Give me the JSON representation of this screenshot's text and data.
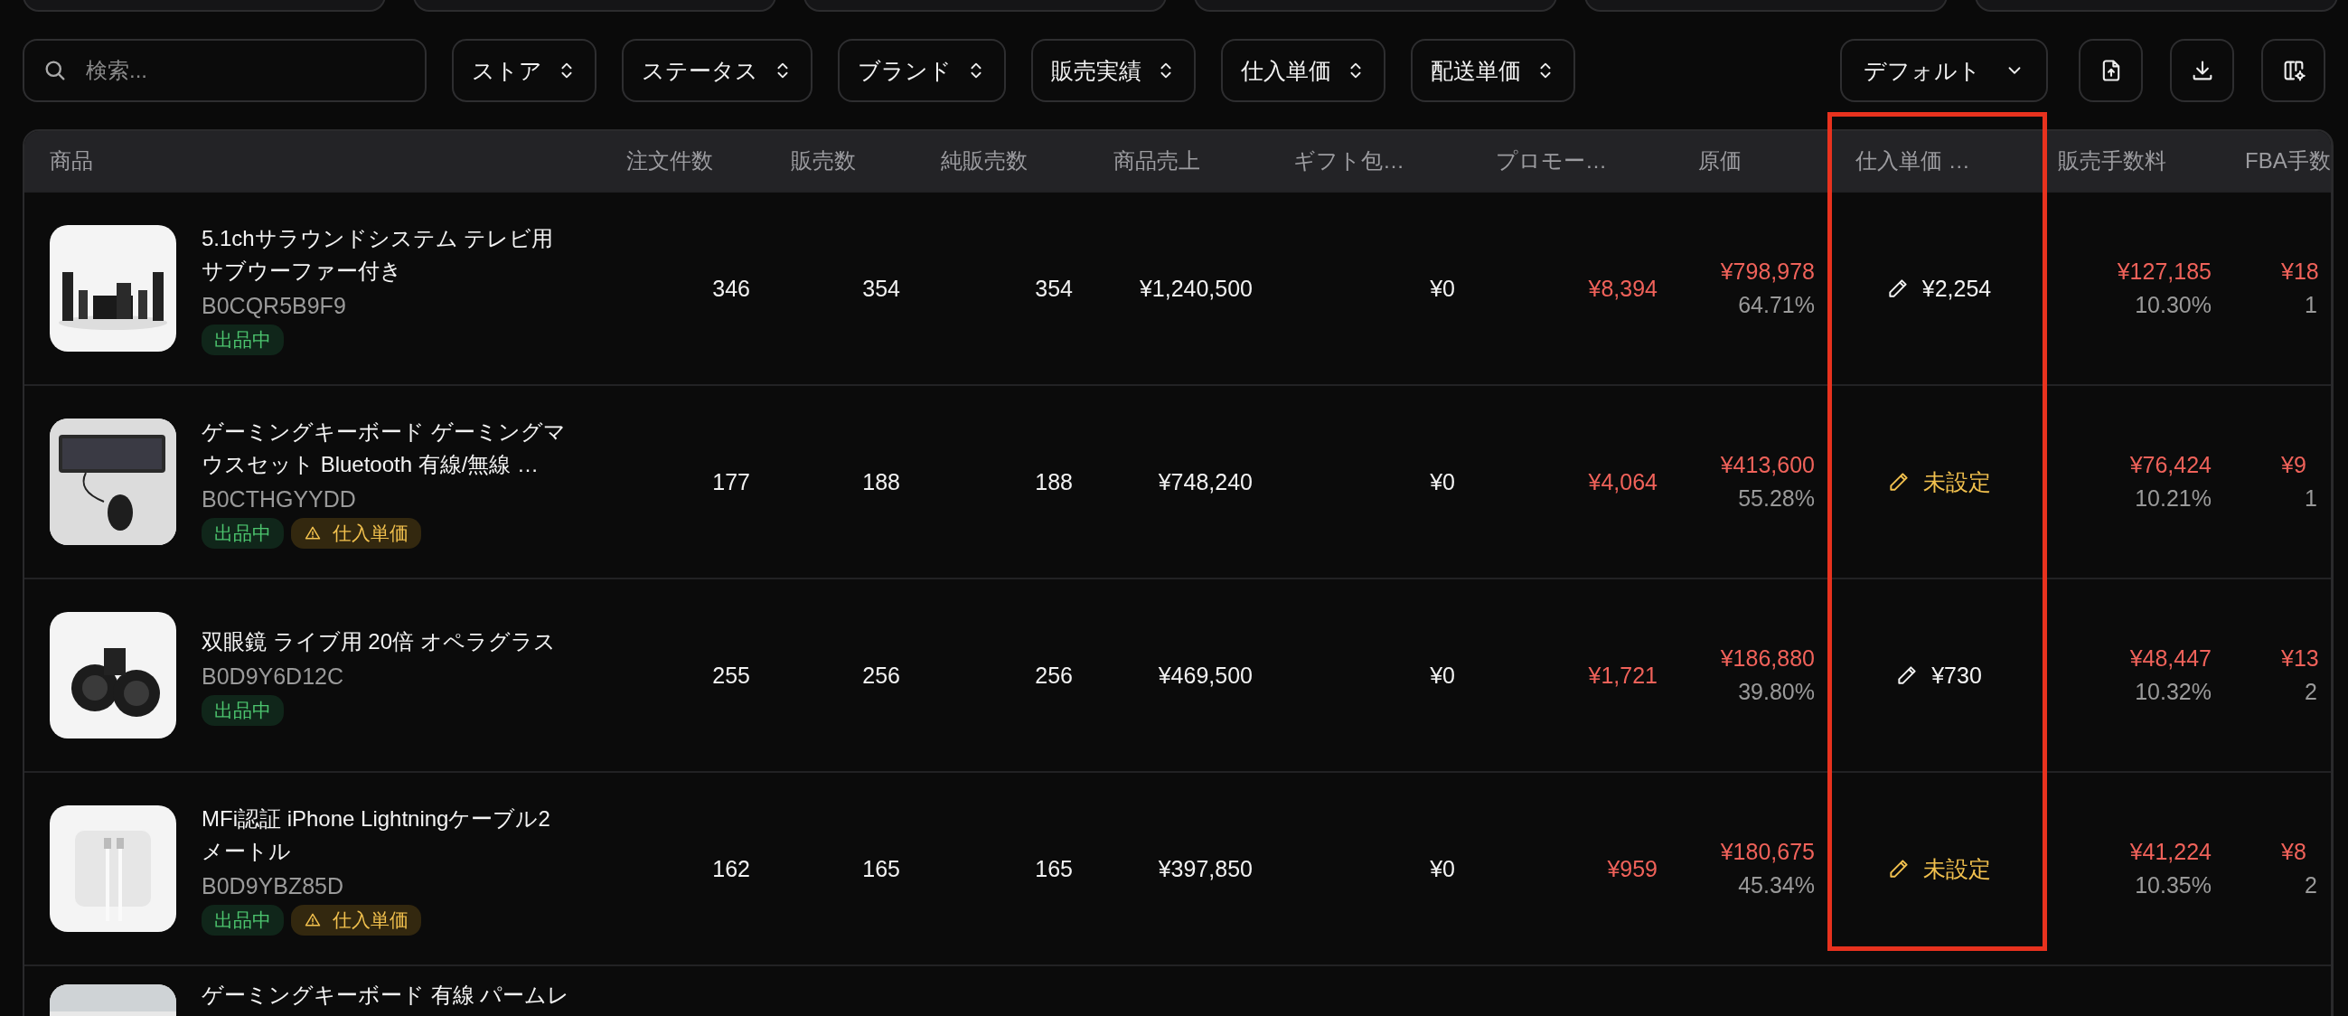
{
  "toolbar": {
    "search": {
      "placeholder": "検索..."
    },
    "filters": [
      "ストア",
      "ステータス",
      "ブランド",
      "販売実績",
      "仕入単価",
      "配送単価"
    ],
    "view_select": "デフォルト"
  },
  "table": {
    "columns": [
      {
        "label": "商品",
        "highlighted": false
      },
      {
        "label": "注文件数",
        "highlighted": false
      },
      {
        "label": "販売数",
        "highlighted": false
      },
      {
        "label": "純販売数",
        "highlighted": false
      },
      {
        "label": "商品売上",
        "highlighted": false
      },
      {
        "label": "ギフト包…",
        "highlighted": false
      },
      {
        "label": "プロモー…",
        "highlighted": false
      },
      {
        "label": "原価",
        "highlighted": false
      },
      {
        "label": "仕入単価 …",
        "highlighted": true
      },
      {
        "label": "販売手数料",
        "highlighted": false
      },
      {
        "label": "FBA手数",
        "highlighted": false
      }
    ],
    "rows": [
      {
        "title": "5.1chサラウンドシステム テレビ用サブウーファー付き",
        "asin": "B0CQR5B9F9",
        "badges": [
          {
            "kind": "listed",
            "label": "出品中"
          }
        ],
        "orders": "346",
        "sold": "354",
        "net_sold": "354",
        "sales": "¥1,240,500",
        "gift": "¥0",
        "promo": "¥8,394",
        "cost": {
          "amount": "¥798,978",
          "pct": "64.71%"
        },
        "unit_cost": {
          "set": true,
          "value": "¥2,254"
        },
        "fee": {
          "amount": "¥127,185",
          "pct": "10.30%"
        },
        "fba": {
          "amount": "¥18",
          "pct": "1"
        }
      },
      {
        "title": "ゲーミングキーボード ゲーミングマウスセット Bluetooth 有線/無線 …",
        "asin": "B0CTHGYYDD",
        "badges": [
          {
            "kind": "listed",
            "label": "出品中"
          },
          {
            "kind": "warning",
            "label": "仕入単価"
          }
        ],
        "orders": "177",
        "sold": "188",
        "net_sold": "188",
        "sales": "¥748,240",
        "gift": "¥0",
        "promo": "¥4,064",
        "cost": {
          "amount": "¥413,600",
          "pct": "55.28%"
        },
        "unit_cost": {
          "set": false,
          "value": "未設定"
        },
        "fee": {
          "amount": "¥76,424",
          "pct": "10.21%"
        },
        "fba": {
          "amount": "¥9",
          "pct": "1"
        }
      },
      {
        "title": "双眼鏡 ライブ用 20倍 オペラグラス",
        "asin": "B0D9Y6D12C",
        "badges": [
          {
            "kind": "listed",
            "label": "出品中"
          }
        ],
        "orders": "255",
        "sold": "256",
        "net_sold": "256",
        "sales": "¥469,500",
        "gift": "¥0",
        "promo": "¥1,721",
        "cost": {
          "amount": "¥186,880",
          "pct": "39.80%"
        },
        "unit_cost": {
          "set": true,
          "value": "¥730"
        },
        "fee": {
          "amount": "¥48,447",
          "pct": "10.32%"
        },
        "fba": {
          "amount": "¥13",
          "pct": "2"
        }
      },
      {
        "title": "MFi認証 iPhone Lightningケーブル2メートル",
        "asin": "B0D9YBZ85D",
        "badges": [
          {
            "kind": "listed",
            "label": "出品中"
          },
          {
            "kind": "warning",
            "label": "仕入単価"
          }
        ],
        "orders": "162",
        "sold": "165",
        "net_sold": "165",
        "sales": "¥397,850",
        "gift": "¥0",
        "promo": "¥959",
        "cost": {
          "amount": "¥180,675",
          "pct": "45.34%"
        },
        "unit_cost": {
          "set": false,
          "value": "未設定"
        },
        "fee": {
          "amount": "¥41,224",
          "pct": "10.35%"
        },
        "fba": {
          "amount": "¥8",
          "pct": "2"
        }
      }
    ],
    "partial_row": {
      "title": "ゲーミングキーボード 有線 パームレ"
    }
  }
}
